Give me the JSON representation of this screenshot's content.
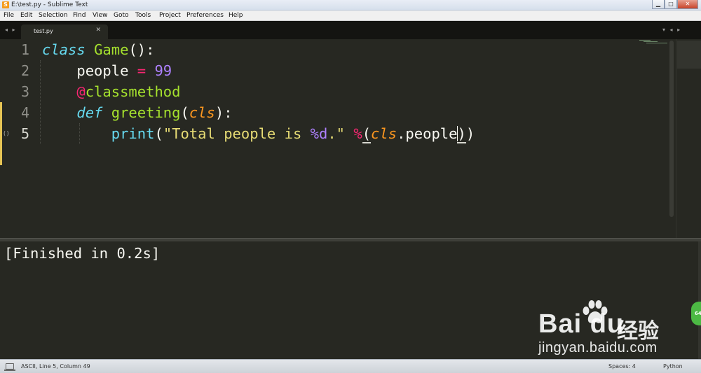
{
  "window": {
    "title": "E:\\test.py - Sublime Text",
    "minimize": "▁",
    "maximize": "□",
    "close": "✕"
  },
  "menu": [
    "File",
    "Edit",
    "Selection",
    "Find",
    "View",
    "Goto",
    "Tools",
    "Project",
    "Preferences",
    "Help"
  ],
  "tabs": {
    "nav_left": "◂ ▸",
    "nav_right": "▾  ◂ ▸",
    "active": {
      "label": "test.py",
      "close": "✕"
    }
  },
  "editor": {
    "line_numbers": [
      "1",
      "2",
      "3",
      "4",
      "5"
    ],
    "fold_marker": "()",
    "tokens": {
      "l1_kw": "class",
      "l1_name": "Game",
      "l1_tail": "():",
      "l2_name": "people",
      "l2_op": "=",
      "l2_num": "99",
      "l3_at": "@",
      "l3_deco": "classmethod",
      "l4_kw": "def",
      "l4_fn": "greeting",
      "l4_open": "(",
      "l4_param": "cls",
      "l4_close": "):",
      "l5_fn": "print",
      "l5_open": "(",
      "l5_str1": "\"Total people is ",
      "l5_fmt": "%d",
      "l5_str2": ".\"",
      "l5_op": "%",
      "l5_paren": "(",
      "l5_param": "cls",
      "l5_attr": ".people",
      "l5_close1": ")",
      "l5_close2": ")"
    }
  },
  "output": {
    "text": "[Finished in 0.2s]"
  },
  "badge": "64",
  "watermark": {
    "brand": "Bai du",
    "cn": "经验",
    "url": "jingyan.baidu.com"
  },
  "status": {
    "position": "ASCII, Line 5, Column 49",
    "spaces": "Spaces: 4",
    "syntax": "Python"
  },
  "colors": {
    "background": "#272822",
    "keyword": "#66d9ef",
    "function": "#a6e22e",
    "operator": "#f92672",
    "number": "#ae81ff",
    "string": "#e6db74",
    "parameter": "#fd971f"
  }
}
